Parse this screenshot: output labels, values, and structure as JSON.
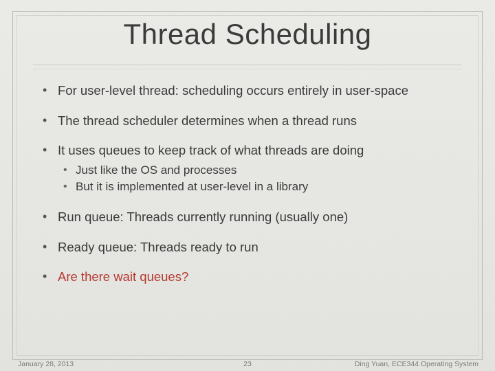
{
  "title": "Thread Scheduling",
  "bullets": {
    "b0": "For user-level thread: scheduling occurs entirely in user-space",
    "b1": "The thread scheduler determines when a thread runs",
    "b2": "It uses queues to keep track of what threads are doing",
    "b2_sub": {
      "s0": "Just like the OS and processes",
      "s1": "But it is implemented at user-level in a library"
    },
    "b3": "Run queue: Threads currently running (usually one)",
    "b4": "Ready queue: Threads ready to run",
    "b5": "Are there wait queues?"
  },
  "footer": {
    "date": "January 28, 2013",
    "page": "23",
    "author": "Ding Yuan, ECE344 Operating System"
  },
  "colors": {
    "highlight": "#b53a2f",
    "text": "#3a3a3a",
    "frame": "#b9b9b6"
  }
}
